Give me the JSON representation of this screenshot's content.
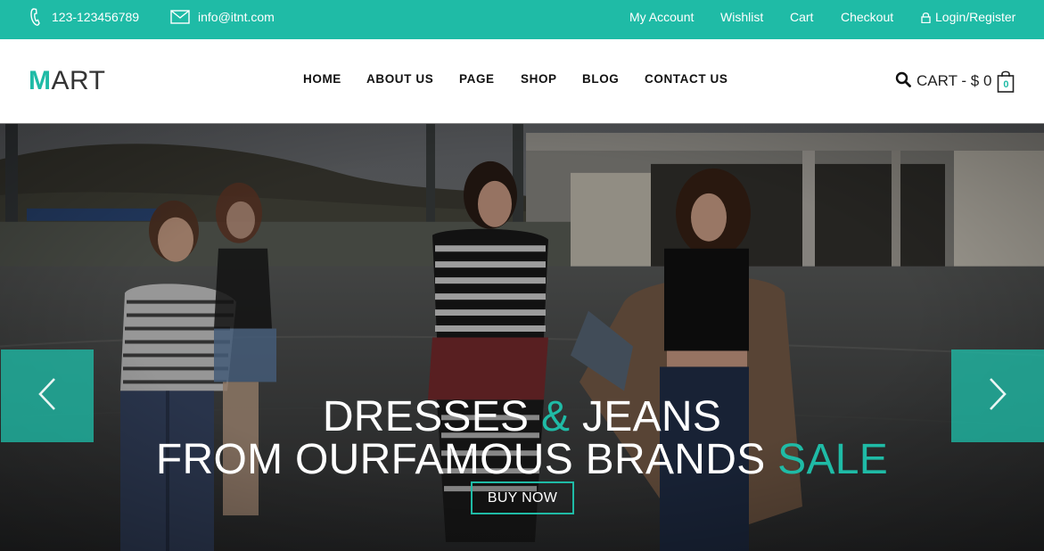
{
  "colors": {
    "accent": "#1fbba6",
    "text_dark": "#111111"
  },
  "topbar": {
    "phone": "123-123456789",
    "email": "info@itnt.com",
    "links": [
      {
        "label": "My Account"
      },
      {
        "label": "Wishlist"
      },
      {
        "label": "Cart"
      },
      {
        "label": "Checkout"
      },
      {
        "label": "Login/Register",
        "icon": "lock-icon"
      }
    ]
  },
  "header": {
    "logo": {
      "first": "M",
      "rest": "ART"
    },
    "nav": [
      "HOME",
      "ABOUT US",
      "PAGE",
      "SHOP",
      "BLOG",
      "CONTACT US"
    ],
    "cart": {
      "label": "CART - $ 0",
      "count": "0",
      "icon": "shopping-bag-icon"
    }
  },
  "hero": {
    "line1_a": "DRESSES",
    "line1_amp": "&",
    "line1_b": "JEANS",
    "line2_a": "FROM OURFAMOUS BRANDS",
    "line2_sale": "SALE",
    "button": "BUY NOW",
    "prev_icon": "chevron-left-icon",
    "next_icon": "chevron-right-icon"
  }
}
